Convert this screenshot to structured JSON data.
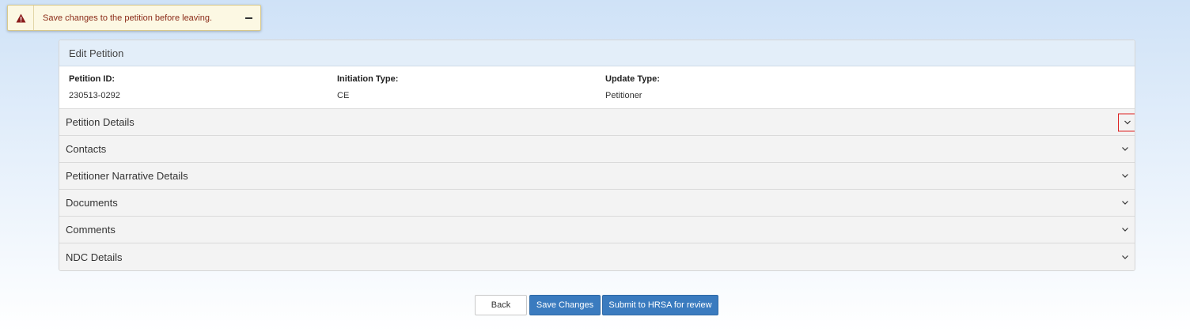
{
  "alert": {
    "icon": "warning-icon",
    "message": "Save changes to the petition before leaving.",
    "color": "#8a2a17"
  },
  "panel": {
    "title": "Edit Petition",
    "info": [
      {
        "label": "Petition ID:",
        "value": "230513-0292"
      },
      {
        "label": "Initiation Type:",
        "value": "CE"
      },
      {
        "label": "Update Type:",
        "value": "Petitioner"
      }
    ],
    "sections": [
      {
        "label": "Petition Details"
      },
      {
        "label": "Contacts"
      },
      {
        "label": "Petitioner Narrative Details"
      },
      {
        "label": "Documents"
      },
      {
        "label": "Comments"
      },
      {
        "label": "NDC Details"
      }
    ]
  },
  "actions": {
    "back": "Back",
    "save": "Save Changes",
    "submit": "Submit to HRSA for review"
  },
  "colors": {
    "primary": "#3a7bbf",
    "alert_bg": "#fcf8e3",
    "focus_outline": "#dd2222"
  }
}
